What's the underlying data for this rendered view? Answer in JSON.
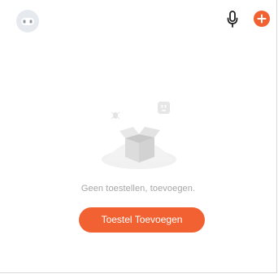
{
  "header": {
    "avatar_icon": "robot-face-icon",
    "mic_icon": "microphone-icon",
    "add_icon": "plus-circle-icon"
  },
  "empty_state": {
    "illustration_icon": "open-box-icon",
    "message": "Geen toestellen, toevoegen.",
    "button_label": "Toestel Toevoegen"
  },
  "colors": {
    "accent": "#f26131",
    "muted_text": "#a6a6a6",
    "avatar_bg": "#e6eaee",
    "illustration_gray": "#e2e2e2"
  }
}
